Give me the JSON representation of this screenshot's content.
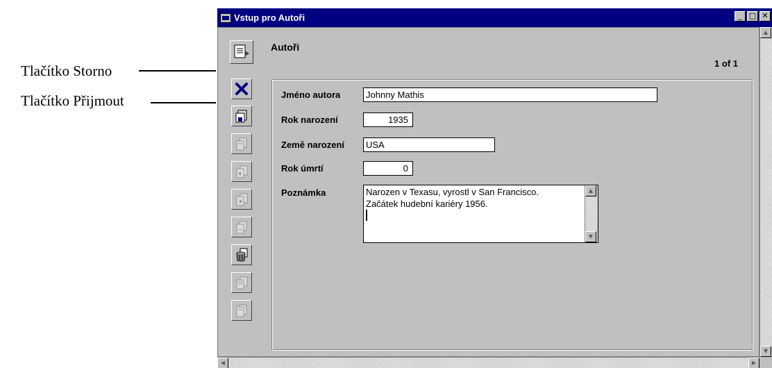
{
  "callouts": {
    "cancel": "Tlačítko Storno",
    "accept": "Tlačítko Přijmout"
  },
  "window": {
    "title": "Vstup pro Autoři",
    "buttons": {
      "minimize": "_",
      "maximize": "□",
      "close": "✕"
    }
  },
  "form": {
    "title": "Autoři",
    "record_count": "1 of 1"
  },
  "toolbar": {
    "icons": [
      "form-icon",
      "cancel-icon",
      "accept-icon",
      "first-record-icon",
      "previous-record-icon",
      "next-record-icon",
      "last-record-icon",
      "delete-record-icon",
      "new-record-icon",
      "print-icon"
    ]
  },
  "fields": {
    "author_name": {
      "label": "Jméno autora",
      "value": "Johnny Mathis"
    },
    "birth_year": {
      "label": "Rok narození",
      "value": "1935"
    },
    "birth_country": {
      "label": "Země narození",
      "value": "USA"
    },
    "death_year": {
      "label": "Rok úmrtí",
      "value": "0"
    },
    "note": {
      "label": "Poznámka",
      "lines": [
        "Narozen v Texasu, vyrostl v San Francisco.",
        "Začátek hudební kariéry 1956."
      ]
    }
  },
  "colors": {
    "titlebar": "#000080",
    "window_bg": "#c0c0c0",
    "cancel_x": "#000080"
  }
}
